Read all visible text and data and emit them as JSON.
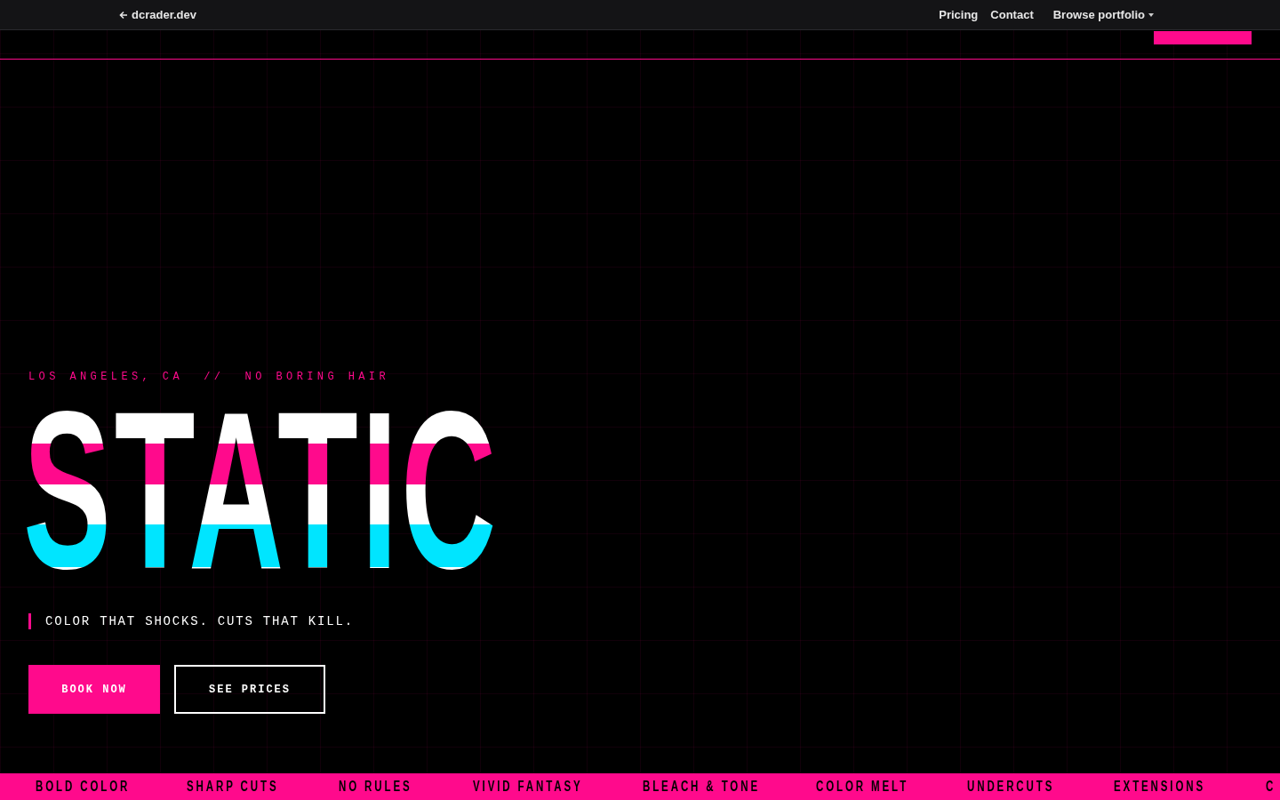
{
  "preview_bar": {
    "back_link": "dcrader.dev",
    "links": [
      "Pricing",
      "Contact"
    ],
    "dropdown": "Browse portfolio"
  },
  "hero": {
    "tagline": "LOS ANGELES, CA  //  NO BORING HAIR",
    "title": "STATIC",
    "quote": "COLOR THAT SHOCKS. CUTS THAT KILL.",
    "buttons": [
      {
        "label": "BOOK NOW",
        "kind": "primary"
      },
      {
        "label": "SEE PRICES",
        "kind": "outline"
      }
    ]
  },
  "marquee": [
    "BOLD COLOR",
    "SHARP CUTS",
    "NO RULES",
    "VIVID FANTASY",
    "BLEACH & TONE",
    "COLOR MELT",
    "UNDERCUTS",
    "EXTENSIONS",
    "C"
  ]
}
